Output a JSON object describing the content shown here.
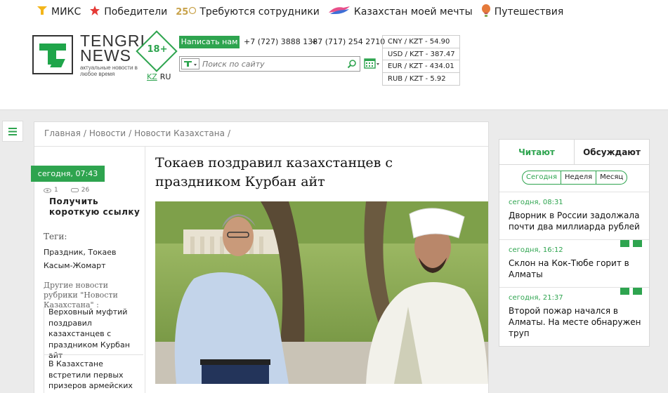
{
  "topnav": [
    {
      "label": "МИКС",
      "icon": "tag-icon"
    },
    {
      "label": "Победители",
      "icon": "star-icon"
    },
    {
      "label": "Требуются сотрудники",
      "icon": "anniversary-icon",
      "badge": "25"
    },
    {
      "label": "Казахстан моей мечты",
      "icon": "wings-icon"
    },
    {
      "label": "Путешествия",
      "icon": "balloon-icon"
    }
  ],
  "logo": {
    "line1": "TENGRI",
    "line2": "NEWS",
    "tagline": "актуальные новости в любое время"
  },
  "age_rating": "18+",
  "lang": {
    "kz": "KZ",
    "ru": "RU"
  },
  "contact": {
    "write_label": "Написать нам",
    "phone1": "+7 (727) 3888 138",
    "phone2": "+7 (717) 254 2710"
  },
  "search": {
    "placeholder": "Поиск по сайту"
  },
  "rates": [
    "CNY / KZT - 54.90",
    "USD / KZT - 387.47",
    "EUR / KZT - 434.01",
    "RUB / KZT - 5.92"
  ],
  "breadcrumb": [
    "Главная",
    "/",
    "Новости",
    "/",
    "Новости Казахстана",
    "/"
  ],
  "article": {
    "date": "сегодня, 07:43",
    "views": "1",
    "comments": "26",
    "shortlink": "Получить короткую ссылку",
    "tags_heading": "Теги:",
    "tags": "Праздник, Токаев Касым-Жомарт",
    "other_heading": "Другие новости рубрики \"Новости Казахстана\" :",
    "related": [
      "Верховный муфтий поздравил казахстанцев с праздником Курбан айт",
      "В Казахстане встретили первых призеров армейских игр"
    ],
    "title": "Токаев поздравил казахстанцев с праздником Курбан айт"
  },
  "widget": {
    "tabs": [
      "Читают",
      "Обсуждают"
    ],
    "periods": [
      "Сегодня",
      "Неделя",
      "Месяц"
    ],
    "items": [
      {
        "date": "сегодня, 08:31",
        "title": "Дворник в России задолжала почти два миллиарда рублей"
      },
      {
        "date": "сегодня, 16:12",
        "title": "Склон на Кок-Тюбе горит в Алматы"
      },
      {
        "date": "сегодня, 21:37",
        "title": "Второй пожар начался в Алматы. На месте обнаружен труп"
      }
    ]
  },
  "colors": {
    "accent": "#2ea44f",
    "background": "#ebebeb"
  }
}
